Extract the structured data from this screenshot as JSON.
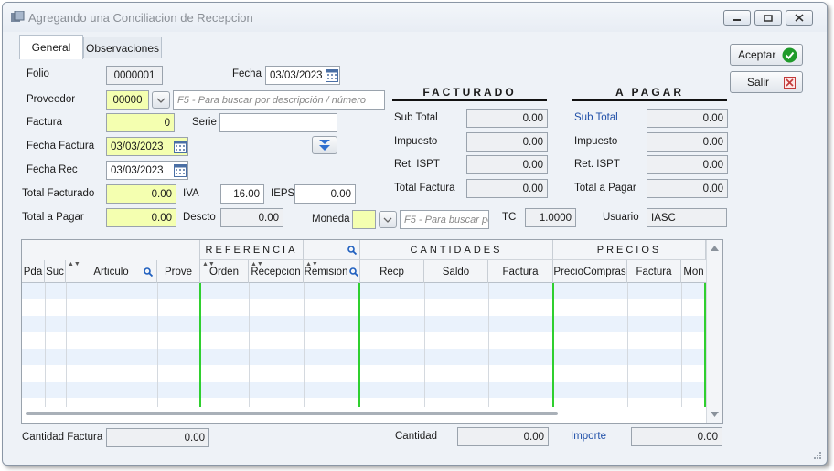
{
  "window": {
    "title": "Agregando una Conciliacion de Recepcion",
    "controls": [
      "minimize-icon",
      "maximize-icon",
      "close-icon"
    ]
  },
  "tabs": [
    {
      "label": "General",
      "active": true
    },
    {
      "label": "Observaciones",
      "active": false
    }
  ],
  "form": {
    "folio_label": "Folio",
    "folio_value": "0000001",
    "fecha_label": "Fecha",
    "fecha_value": "03/03/2023",
    "proveedor_label": "Proveedor",
    "proveedor_value": "00000",
    "proveedor_placeholder": "F5 - Para buscar por descripción / número",
    "factura_label": "Factura",
    "factura_value": "0",
    "serie_label": "Serie",
    "serie_value": "",
    "fecha_factura_label": "Fecha Factura",
    "fecha_factura_value": "03/03/2023",
    "fecha_rec_label": "Fecha Rec",
    "fecha_rec_value": "03/03/2023",
    "total_facturado_label": "Total Facturado",
    "total_facturado_value": "0.00",
    "iva_label": "IVA",
    "iva_value": "16.00",
    "ieps_label": "IEPS",
    "ieps_value": "0.00",
    "total_pagar_label": "Total a Pagar",
    "total_pagar_value": "0.00",
    "descto_label": "Descto",
    "descto_value": "0.00",
    "moneda_label": "Moneda",
    "moneda_value": "",
    "moneda_placeholder": "F5 - Para buscar por",
    "tc_label": "TC",
    "tc_value": "1.0000",
    "usuario_label": "Usuario",
    "usuario_value": "IASC"
  },
  "facturado": {
    "title": "FACTURADO",
    "subtotal_label": "Sub Total",
    "subtotal_value": "0.00",
    "impuesto_label": "Impuesto",
    "impuesto_value": "0.00",
    "ret_label": "Ret. ISPT",
    "ret_value": "0.00",
    "total_label": "Total Factura",
    "total_value": "0.00"
  },
  "apagar": {
    "title": "A PAGAR",
    "subtotal_label": "Sub Total",
    "subtotal_value": "0.00",
    "impuesto_label": "Impuesto",
    "impuesto_value": "0.00",
    "ret_label": "Ret. ISPT",
    "ret_value": "0.00",
    "total_label": "Total a Pagar",
    "total_value": "0.00"
  },
  "buttons": {
    "aceptar": "Aceptar",
    "salir": "Salir"
  },
  "grid": {
    "groups": {
      "referencia": "REFERENCIA",
      "cantidades": "CANTIDADES",
      "precios": "PRECIOS"
    },
    "columns": [
      "Pda",
      "Suc",
      "Articulo",
      "Prove",
      "Orden",
      "Recepcion",
      "Remision",
      "Recp",
      "Saldo",
      "Factura",
      "PrecioCompras",
      "Factura",
      "Mon"
    ]
  },
  "footer": {
    "cantidad_factura_label": "Cantidad Factura",
    "cantidad_factura_value": "0.00",
    "cantidad_label": "Cantidad",
    "cantidad_value": "0.00",
    "importe_label": "Importe",
    "importe_value": "0.00"
  },
  "colors": {
    "accent_yellow": "#f4ffb0",
    "grid_green_line": "#2fcf2f",
    "link_blue": "#1f4fa8",
    "row_alt": "#eaf2fc"
  }
}
